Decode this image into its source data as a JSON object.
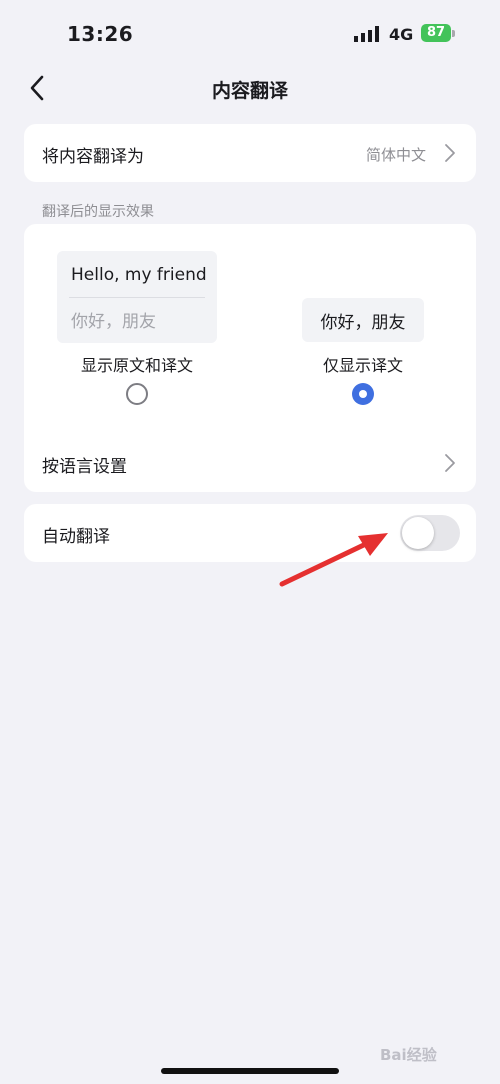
{
  "status_bar": {
    "time": "13:26",
    "network": "4G",
    "battery": "87"
  },
  "nav": {
    "title": "内容翻译"
  },
  "translate_to": {
    "label": "将内容翻译为",
    "value": "简体中文"
  },
  "display_section": {
    "header": "翻译后的显示效果",
    "option_original": {
      "preview_en": "Hello, my friend",
      "preview_zh": "你好，朋友",
      "label": "显示原文和译文",
      "selected": false
    },
    "option_translation": {
      "preview_zh": "你好，朋友",
      "label": "仅显示译文",
      "selected": true
    },
    "by_language": {
      "label": "按语言设置"
    }
  },
  "auto_translate": {
    "label": "自动翻译",
    "enabled": false
  },
  "watermark": "Bai经验",
  "colors": {
    "accent": "#3f6fe0",
    "battery": "#43c35a",
    "arrow": "#e53030",
    "background": "#f2f2f7"
  }
}
